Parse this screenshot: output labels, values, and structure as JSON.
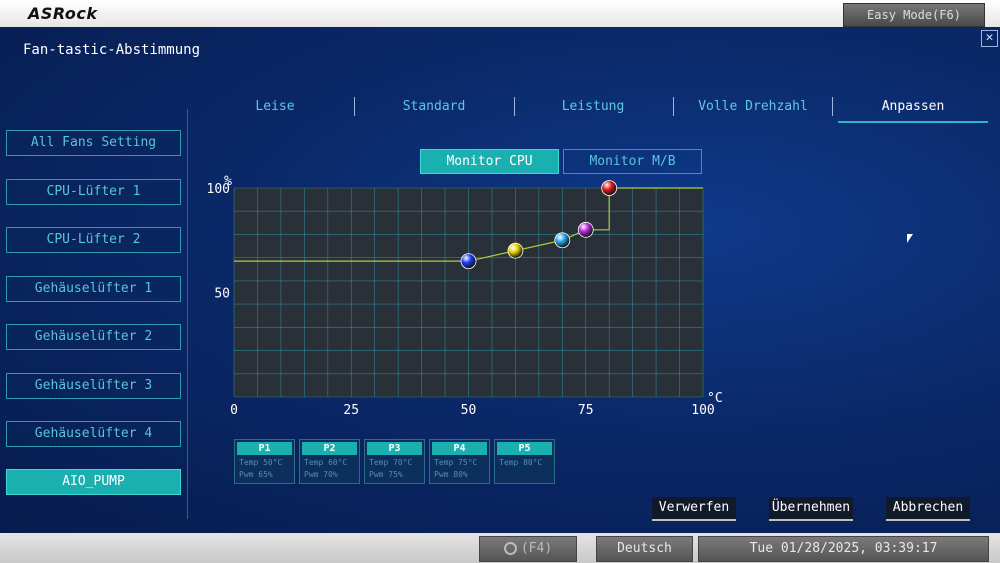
{
  "brand": "ASRock",
  "easy_mode": "Easy Mode(F6)",
  "page_title": "Fan-tastic-Abstimmung",
  "close_glyph": "✕",
  "tabs": [
    {
      "label": "Leise"
    },
    {
      "label": "Standard"
    },
    {
      "label": "Leistung"
    },
    {
      "label": "Volle Drehzahl"
    },
    {
      "label": "Anpassen",
      "active": true
    }
  ],
  "sidebar": [
    {
      "label": "All Fans Setting"
    },
    {
      "label": "CPU-Lüfter 1"
    },
    {
      "label": "CPU-Lüfter 2"
    },
    {
      "label": "Gehäuselüfter 1"
    },
    {
      "label": "Gehäuselüfter 2"
    },
    {
      "label": "Gehäuselüfter 3"
    },
    {
      "label": "Gehäuselüfter 4"
    },
    {
      "label": "AIO_PUMP",
      "active": true
    }
  ],
  "monitor": {
    "cpu": "Monitor CPU",
    "mb": "Monitor M/B",
    "selected": "cpu"
  },
  "chart_data": {
    "type": "line",
    "y_unit": "%",
    "x_unit": "°C",
    "xlim": [
      0,
      100
    ],
    "ylim": [
      0,
      100
    ],
    "x_ticks": [
      "0",
      "25",
      "50",
      "75",
      "100"
    ],
    "y_ticks": [
      "100",
      "50"
    ],
    "grid": true,
    "curve": [
      [
        0,
        65
      ],
      [
        50,
        65
      ],
      [
        60,
        70
      ],
      [
        70,
        75
      ],
      [
        75,
        80
      ],
      [
        80,
        80
      ],
      [
        80,
        100
      ],
      [
        100,
        100
      ]
    ],
    "points": [
      {
        "name": "P1",
        "x": 50,
        "y": 65,
        "color": "#1c3cff"
      },
      {
        "name": "P2",
        "x": 60,
        "y": 70,
        "color": "#e8d000"
      },
      {
        "name": "P3",
        "x": 70,
        "y": 75,
        "color": "#2aa8e8"
      },
      {
        "name": "P4",
        "x": 75,
        "y": 80,
        "color": "#b42ad8"
      },
      {
        "name": "P5",
        "x": 80,
        "y": 100,
        "color": "#e81818"
      }
    ]
  },
  "point_table": [
    {
      "name": "P1",
      "temp": "Temp 50°C",
      "pwm": "Pwm  65%"
    },
    {
      "name": "P2",
      "temp": "Temp 60°C",
      "pwm": "Pwm  70%"
    },
    {
      "name": "P3",
      "temp": "Temp 70°C",
      "pwm": "Pwm  75%"
    },
    {
      "name": "P4",
      "temp": "Temp 75°C",
      "pwm": "Pwm  80%"
    },
    {
      "name": "P5",
      "temp": "Temp 80°C",
      "pwm": ""
    }
  ],
  "actions": {
    "discard": "Verwerfen",
    "apply": "Übernehmen",
    "cancel": "Abbrechen"
  },
  "bottom": {
    "search": "(F4)",
    "language": "Deutsch",
    "datetime": "Tue 01/28/2025, 03:39:17"
  },
  "colors": {
    "accent": "#1ab0b0",
    "background": "#0a2a6e",
    "curve": "#a8d040"
  }
}
